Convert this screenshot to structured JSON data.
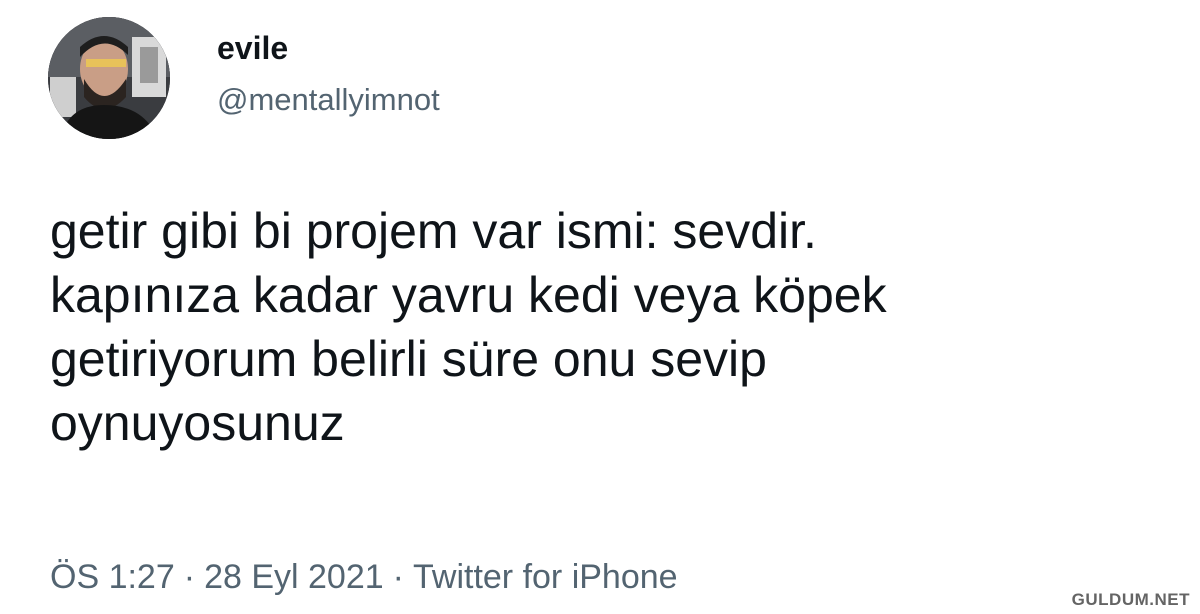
{
  "tweet": {
    "author": {
      "display_name": "evile",
      "handle": "@mentallyimnot",
      "avatar_icon": "profile-photo"
    },
    "text_lines": [
      "getir gibi bi projem var ismi: sevdir.",
      "kapınıza kadar yavru kedi veya köpek",
      "getiriyorum belirli süre onu sevip",
      "oynuyosunuz"
    ],
    "meta": {
      "time": "ÖS 1:27",
      "separator": "·",
      "date": "28 Eyl 2021",
      "source": "Twitter for iPhone"
    }
  },
  "watermark": "GULDUM.NET",
  "colors": {
    "text_primary": "#0f1419",
    "text_secondary": "#536471",
    "background": "#ffffff"
  }
}
